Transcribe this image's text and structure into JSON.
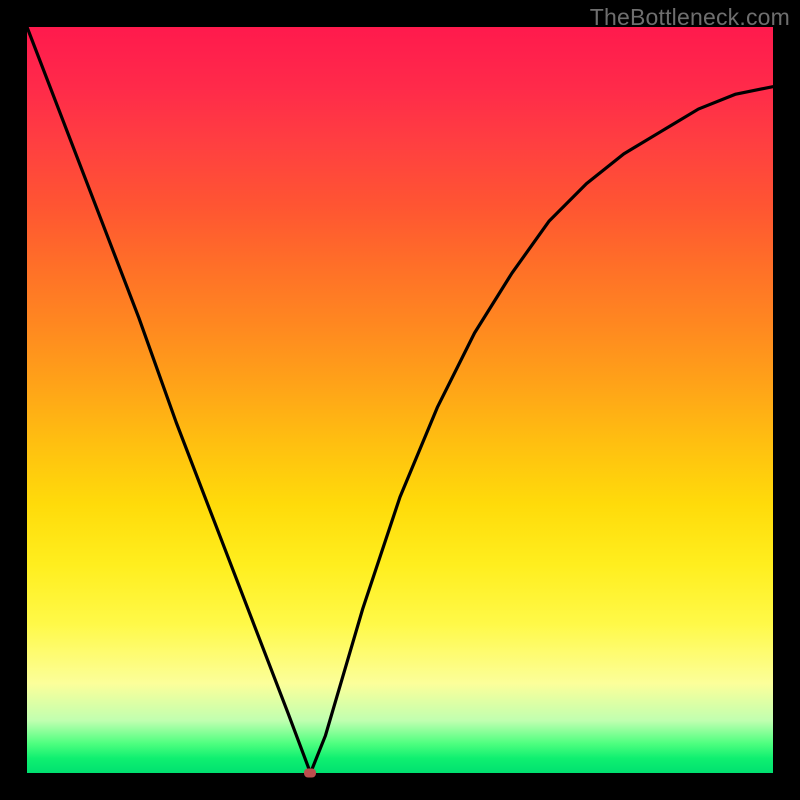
{
  "watermark": "TheBottleneck.com",
  "chart_data": {
    "type": "line",
    "title": "",
    "xlabel": "",
    "ylabel": "",
    "xlim": [
      0,
      100
    ],
    "ylim": [
      0,
      100
    ],
    "grid": false,
    "series": [
      {
        "name": "curve",
        "x": [
          0,
          5,
          10,
          15,
          20,
          25,
          30,
          35,
          38,
          40,
          45,
          50,
          55,
          60,
          65,
          70,
          75,
          80,
          85,
          90,
          95,
          100
        ],
        "y": [
          100,
          87,
          74,
          61,
          47,
          34,
          21,
          8,
          0,
          5,
          22,
          37,
          49,
          59,
          67,
          74,
          79,
          83,
          86,
          89,
          91,
          92
        ]
      }
    ],
    "marker": {
      "x": 38,
      "y": 0,
      "color": "#bb4d4d"
    },
    "background_gradient": {
      "top": "#ff1a4d",
      "mid": "#ffd900",
      "bottom": "#00e070"
    }
  }
}
